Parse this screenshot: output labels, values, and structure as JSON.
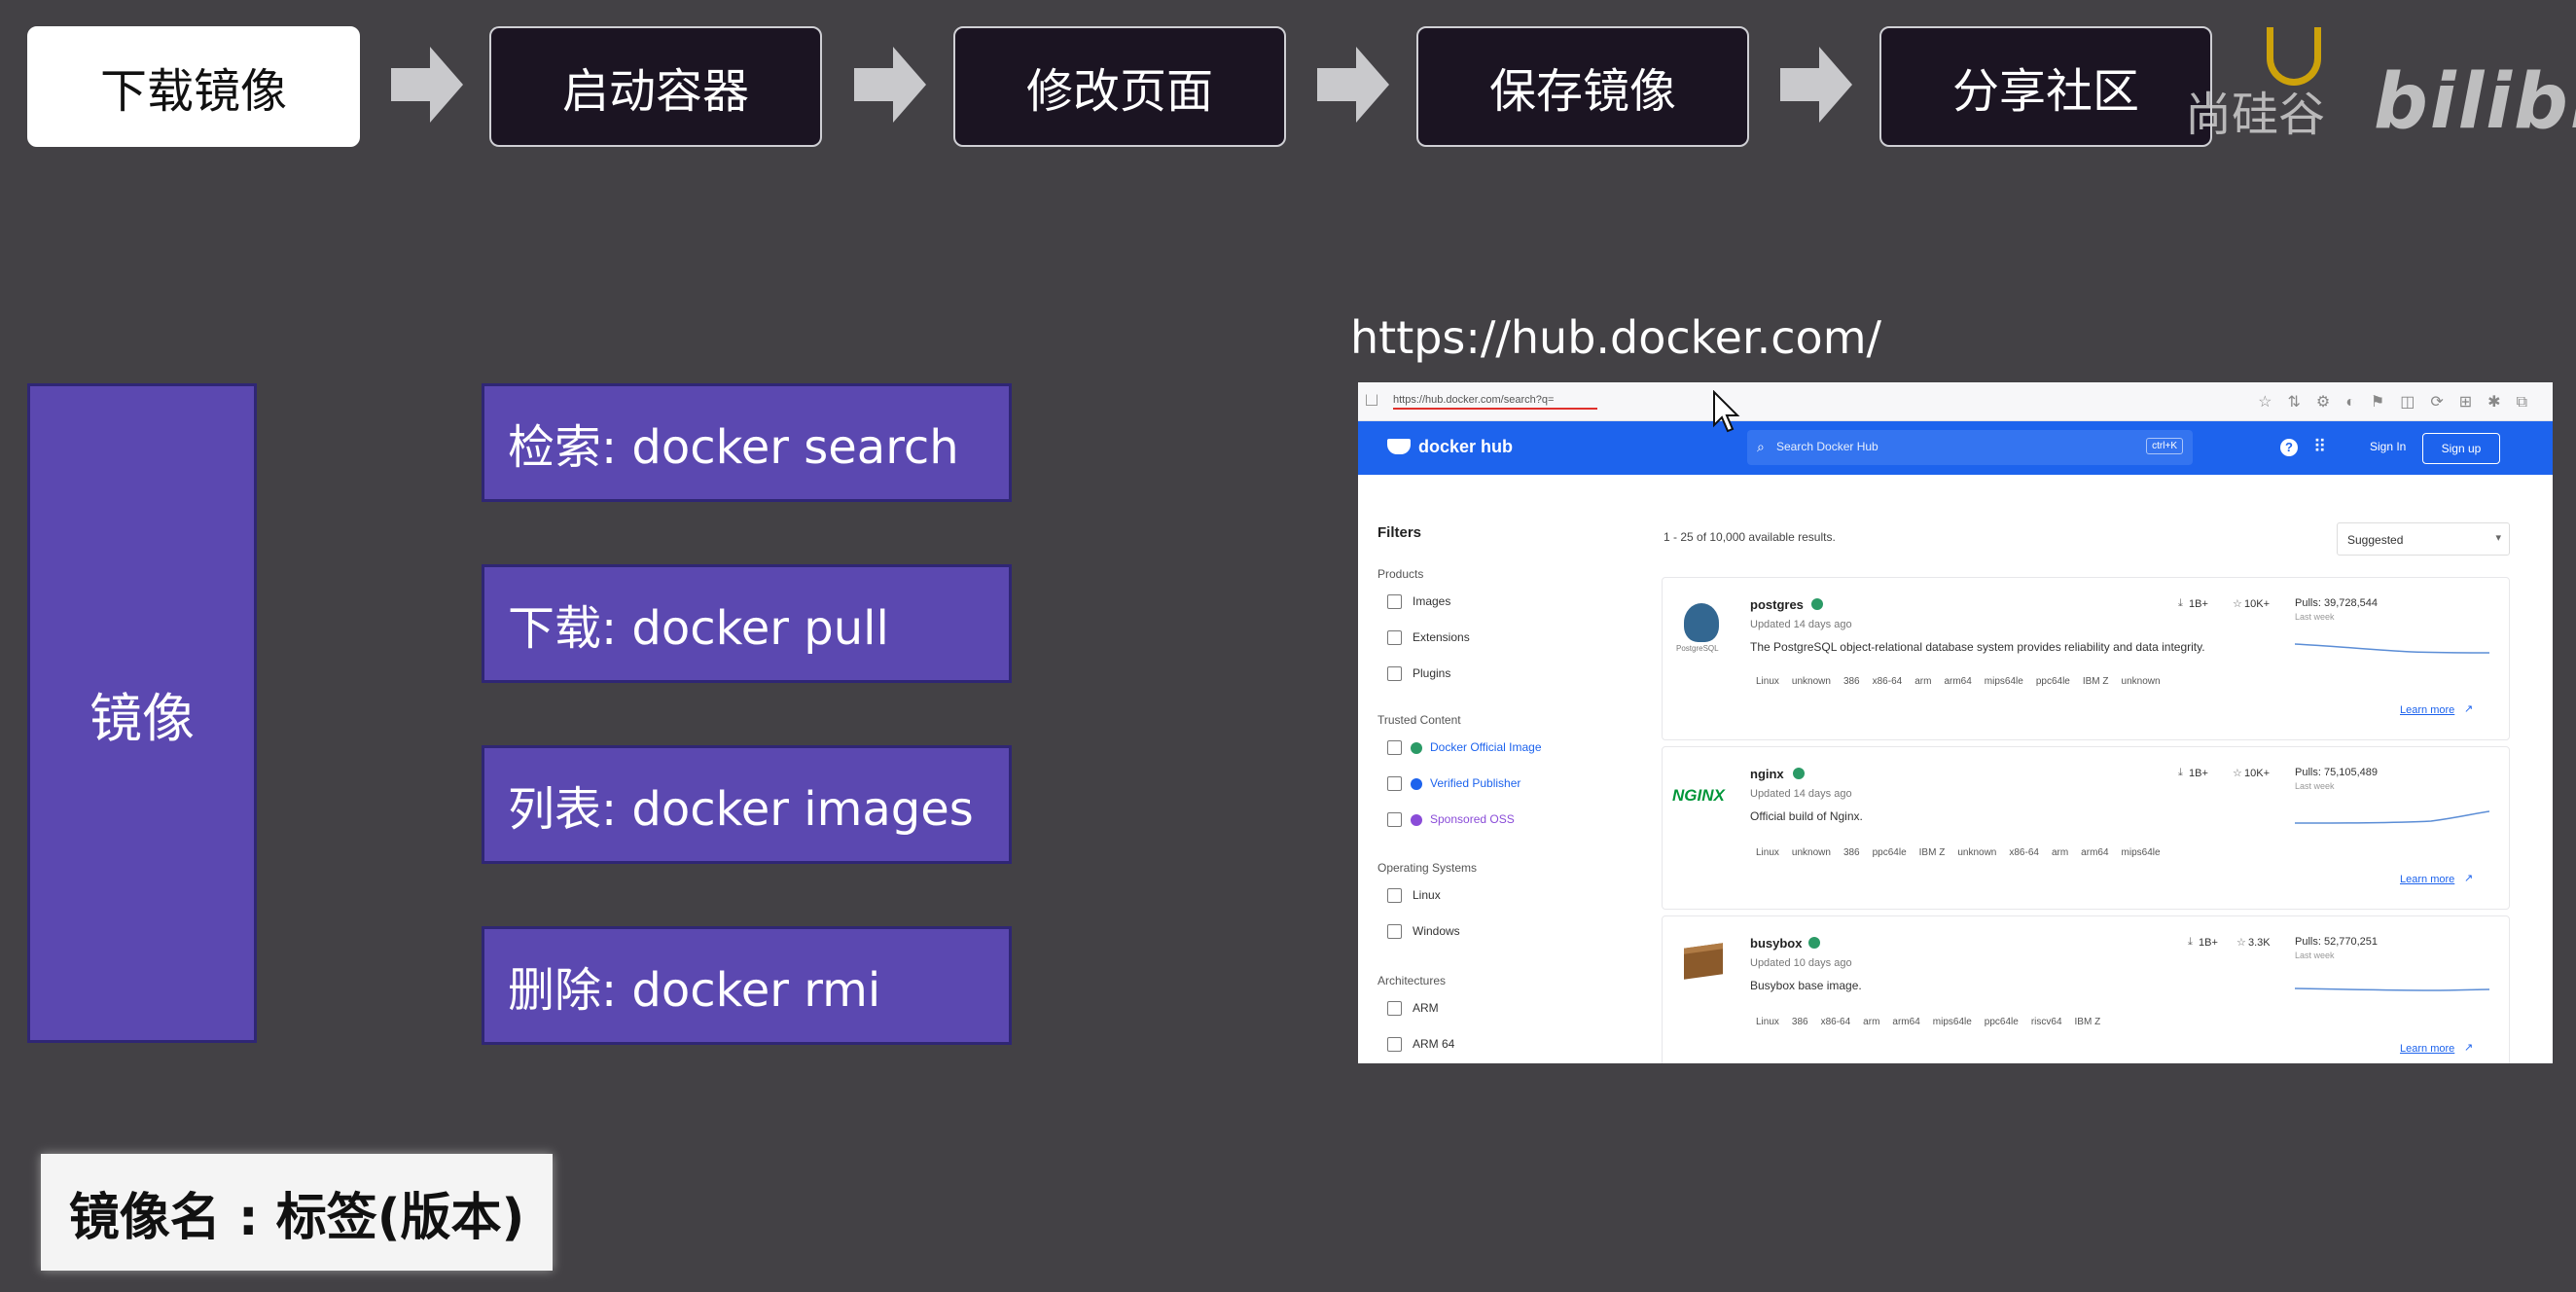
{
  "flow": [
    "下载镜像",
    "启动容器",
    "修改页面",
    "保存镜像",
    "分享社区"
  ],
  "watermark": {
    "org": "尚硅谷",
    "site": "bilibili"
  },
  "main_label": "镜像",
  "commands": [
    "检索: docker search",
    "下载: docker pull",
    "列表: docker images",
    "删除: docker rmi"
  ],
  "hub_url": "https://hub.docker.com/",
  "note": "镜像名 : 标签(版本)",
  "browser": {
    "address": "https://hub.docker.com/search?q="
  },
  "dockerhub": {
    "logo": "docker hub",
    "search_placeholder": "Search Docker Hub",
    "shortcut": "ctrl+K",
    "help": "?",
    "sign_in": "Sign In",
    "sign_up": "Sign up",
    "filters_title": "Filters",
    "products_label": "Products",
    "products": [
      "Images",
      "Extensions",
      "Plugins"
    ],
    "trusted_label": "Trusted Content",
    "trusted": [
      "Docker Official Image",
      "Verified Publisher",
      "Sponsored OSS"
    ],
    "os_label": "Operating Systems",
    "os": [
      "Linux",
      "Windows"
    ],
    "arch_label": "Architectures",
    "arch": [
      "ARM",
      "ARM 64"
    ],
    "results_count": "1 - 25 of 10,000 available results.",
    "sort": "Suggested",
    "results": [
      {
        "name": "postgres",
        "logo_text": "PostgreSQL",
        "updated": "Updated 14 days ago",
        "desc": "The PostgreSQL object-relational database system provides reliability and data integrity.",
        "downloads": "1B+",
        "stars": "10K+",
        "pulls": "Pulls: 39,728,544",
        "last_week": "Last week",
        "learn_more": "Learn more",
        "tags": [
          "Linux",
          "unknown",
          "386",
          "x86-64",
          "arm",
          "arm64",
          "mips64le",
          "ppc64le",
          "IBM Z",
          "unknown"
        ]
      },
      {
        "name": "nginx",
        "logo_text": "NGINX",
        "updated": "Updated 14 days ago",
        "desc": "Official build of Nginx.",
        "downloads": "1B+",
        "stars": "10K+",
        "pulls": "Pulls: 75,105,489",
        "last_week": "Last week",
        "learn_more": "Learn more",
        "tags": [
          "Linux",
          "unknown",
          "386",
          "ppc64le",
          "IBM Z",
          "unknown",
          "x86-64",
          "arm",
          "arm64",
          "mips64le"
        ]
      },
      {
        "name": "busybox",
        "logo_text": "",
        "updated": "Updated 10 days ago",
        "desc": "Busybox base image.",
        "downloads": "1B+",
        "stars": "3.3K",
        "pulls": "Pulls: 52,770,251",
        "last_week": "Last week",
        "learn_more": "Learn more",
        "tags": [
          "Linux",
          "386",
          "x86-64",
          "arm",
          "arm64",
          "mips64le",
          "ppc64le",
          "riscv64",
          "IBM Z"
        ]
      }
    ]
  }
}
